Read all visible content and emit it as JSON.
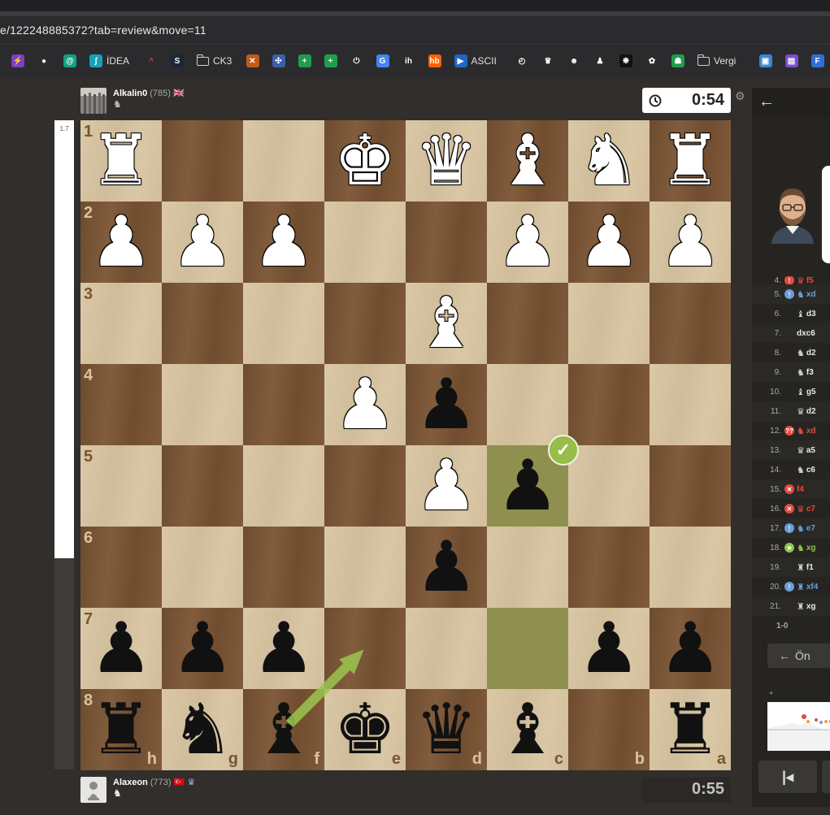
{
  "browser": {
    "url": "e/122248885372?tab=review&move=11",
    "bookmarks": [
      {
        "icon": "bolt-icon",
        "label": "",
        "color": "#7b3fc4",
        "glyph": "⚡"
      },
      {
        "icon": "map-pin-icon",
        "label": "",
        "color": "#2b2b2e",
        "glyph": "●"
      },
      {
        "icon": "chatgpt-spiral-icon",
        "label": "",
        "color": "#10a37f",
        "glyph": "@"
      },
      {
        "icon": "idea-icon",
        "label": "İDEA",
        "color": "#15a2b8",
        "glyph": "ʃ"
      },
      {
        "icon": "chevron-up-red-icon",
        "label": "",
        "color": "#2b2b2e",
        "glyph": "^"
      },
      {
        "icon": "steam-icon",
        "label": "",
        "color": "#1b2838",
        "glyph": "S"
      },
      {
        "icon": "folder-icon",
        "label": "CK3",
        "color": "",
        "glyph": ""
      },
      {
        "icon": "crossed-tools-icon",
        "label": "",
        "color": "#c25a1a",
        "glyph": "✕"
      },
      {
        "icon": "pinwheel-icon",
        "label": "",
        "color": "#3a5fa8",
        "glyph": "✣"
      },
      {
        "icon": "green-cross-icon",
        "label": "",
        "color": "#1e9e4a",
        "glyph": "+"
      },
      {
        "icon": "green-cross-icon-2",
        "label": "",
        "color": "#1e9e4a",
        "glyph": "+"
      },
      {
        "icon": "power-icon",
        "label": "",
        "color": "#2b2b2e",
        "glyph": "⏻"
      },
      {
        "icon": "translate-icon",
        "label": "",
        "color": "#4285f4",
        "glyph": "G"
      },
      {
        "icon": "ih-icon",
        "label": "",
        "color": "#2b2b2e",
        "glyph": "ih"
      },
      {
        "icon": "hb-icon",
        "label": "",
        "color": "#ff6000",
        "glyph": "hb"
      },
      {
        "icon": "play-icon",
        "label": "ASCII",
        "color": "#1e66c9",
        "glyph": "▶"
      },
      {
        "icon": "speedometer-icon",
        "label": "",
        "color": "#2b2b2e",
        "glyph": "◴"
      },
      {
        "icon": "crown-icon",
        "label": "",
        "color": "#2b2b2e",
        "glyph": "♛"
      },
      {
        "icon": "alien-icon",
        "label": "",
        "color": "#2b2b2e",
        "glyph": "☻"
      },
      {
        "icon": "chess-pawn-icon",
        "label": "",
        "color": "#2b2b2e",
        "glyph": "♟"
      },
      {
        "icon": "snowflake-icon",
        "label": "",
        "color": "#111111",
        "glyph": "❋"
      },
      {
        "icon": "openai-icon",
        "label": "",
        "color": "#2b2b2e",
        "glyph": "✿"
      },
      {
        "icon": "android-icon",
        "label": "",
        "color": "#1e9e4a",
        "glyph": "☗"
      },
      {
        "icon": "folder-icon-2",
        "label": "Vergi",
        "color": "",
        "glyph": ""
      },
      {
        "icon": "id-card-icon",
        "label": "",
        "color": "#3a86d4",
        "glyph": "▣"
      },
      {
        "icon": "purple-stack-icon",
        "label": "",
        "color": "#7d4ad1",
        "glyph": "▤"
      },
      {
        "icon": "f-icon",
        "label": "",
        "color": "#2f6fd6",
        "glyph": "F"
      }
    ]
  },
  "top_player": {
    "name": "Alkalin0",
    "rating": "(785)",
    "flag": "🇬🇧",
    "clock": "0:54"
  },
  "bottom_player": {
    "name": "Alaxeon",
    "rating": "(773)",
    "flag": "🇹🇷",
    "clock": "0:55"
  },
  "eval_bar": {
    "score": "1.7",
    "white_fraction": 0.675
  },
  "board": {
    "orientation": "black",
    "light_color": "#d8c4a1",
    "dark_color": "#7a5433",
    "highlight_squares": [
      "c5",
      "c7"
    ],
    "pieces": [
      {
        "square": "a1",
        "type": "rook",
        "color": "white"
      },
      {
        "square": "e1",
        "type": "king",
        "color": "white"
      },
      {
        "square": "d1",
        "type": "queen",
        "color": "white"
      },
      {
        "square": "c1",
        "type": "bishop",
        "color": "white"
      },
      {
        "square": "b1",
        "type": "knight",
        "color": "white"
      },
      {
        "square": "h1",
        "type": "rook",
        "color": "white"
      },
      {
        "square": "h2",
        "type": "pawn",
        "color": "white"
      },
      {
        "square": "g2",
        "type": "pawn",
        "color": "white"
      },
      {
        "square": "f2",
        "type": "pawn",
        "color": "white"
      },
      {
        "square": "c2",
        "type": "pawn",
        "color": "white"
      },
      {
        "square": "b2",
        "type": "pawn",
        "color": "white"
      },
      {
        "square": "a2",
        "type": "pawn",
        "color": "white"
      },
      {
        "square": "d3",
        "type": "bishop",
        "color": "white"
      },
      {
        "square": "e4",
        "type": "pawn",
        "color": "white"
      },
      {
        "square": "d4",
        "type": "pawn",
        "color": "black"
      },
      {
        "square": "d5",
        "type": "pawn",
        "color": "white"
      },
      {
        "square": "c5",
        "type": "pawn",
        "color": "black"
      },
      {
        "square": "d6",
        "type": "pawn",
        "color": "black"
      },
      {
        "square": "h7",
        "type": "pawn",
        "color": "black"
      },
      {
        "square": "g7",
        "type": "pawn",
        "color": "black"
      },
      {
        "square": "f7",
        "type": "pawn",
        "color": "black"
      },
      {
        "square": "b7",
        "type": "pawn",
        "color": "black"
      },
      {
        "square": "a7",
        "type": "pawn",
        "color": "black"
      },
      {
        "square": "h8",
        "type": "rook",
        "color": "black"
      },
      {
        "square": "g8",
        "type": "knight",
        "color": "black"
      },
      {
        "square": "f8",
        "type": "bishop",
        "color": "black"
      },
      {
        "square": "e8",
        "type": "king",
        "color": "black"
      },
      {
        "square": "d8",
        "type": "queen",
        "color": "black"
      },
      {
        "square": "c8",
        "type": "bishop",
        "color": "black"
      },
      {
        "square": "a8",
        "type": "rook",
        "color": "black"
      }
    ],
    "arrow": {
      "from": "f8",
      "to": "e7",
      "color": "#9bc54d"
    },
    "move_badge": {
      "square": "c5",
      "icon": "checkmark-icon",
      "color": "#96bc4b"
    }
  },
  "review_panel": {
    "back_icon": "back-arrow-icon",
    "moves": [
      {
        "num": "4.",
        "badge": "mistake",
        "badge_color": "#e6493d",
        "piece": "♛",
        "san": "f5",
        "color": "#e6493d"
      },
      {
        "num": "5.",
        "badge": "inaccuracy",
        "badge_color": "#6b9ed6",
        "piece": "♞",
        "san": "xd",
        "color": "#6b9ed6"
      },
      {
        "num": "6.",
        "badge": "",
        "badge_color": "",
        "piece": "♝",
        "san": "d3",
        "color": "#e8e8e8"
      },
      {
        "num": "7.",
        "badge": "",
        "badge_color": "",
        "piece": "",
        "san": "dxc6",
        "color": "#e8e8e8"
      },
      {
        "num": "8.",
        "badge": "",
        "badge_color": "",
        "piece": "♞",
        "san": "d2",
        "color": "#e8e8e8"
      },
      {
        "num": "9.",
        "badge": "",
        "badge_color": "",
        "piece": "♞",
        "san": "f3",
        "color": "#e8e8e8"
      },
      {
        "num": "10.",
        "badge": "",
        "badge_color": "",
        "piece": "♝",
        "san": "g5",
        "color": "#e8e8e8"
      },
      {
        "num": "11.",
        "badge": "",
        "badge_color": "",
        "piece": "♛",
        "san": "d2",
        "color": "#e8e8e8"
      },
      {
        "num": "12.",
        "badge": "??",
        "badge_color": "#e6493d",
        "piece": "♞",
        "san": "xd",
        "color": "#e6493d"
      },
      {
        "num": "13.",
        "badge": "",
        "badge_color": "",
        "piece": "♛",
        "san": "a5",
        "color": "#e8e8e8"
      },
      {
        "num": "14.",
        "badge": "",
        "badge_color": "",
        "piece": "♞",
        "san": "c6",
        "color": "#e8e8e8"
      },
      {
        "num": "15.",
        "badge": "✕",
        "badge_color": "#e6493d",
        "piece": "",
        "san": "f4",
        "color": "#e6493d"
      },
      {
        "num": "16.",
        "badge": "✕",
        "badge_color": "#e6493d",
        "piece": "♛",
        "san": "c7",
        "color": "#e6493d"
      },
      {
        "num": "17.",
        "badge": "!",
        "badge_color": "#6b9ed6",
        "piece": "♞",
        "san": "e7",
        "color": "#6b9ed6"
      },
      {
        "num": "18.",
        "badge": "★",
        "badge_color": "#8bc34a",
        "piece": "♞",
        "san": "xg",
        "color": "#8bc34a"
      },
      {
        "num": "19.",
        "badge": "",
        "badge_color": "",
        "piece": "♜",
        "san": "f1",
        "color": "#e8e8e8"
      },
      {
        "num": "20.",
        "badge": "!",
        "badge_color": "#6b9ed6",
        "piece": "♜",
        "san": "xf4",
        "color": "#6b9ed6"
      },
      {
        "num": "21.",
        "badge": "",
        "badge_color": "",
        "piece": "♜",
        "san": "xg",
        "color": "#e8e8e8"
      }
    ],
    "result": "1-0",
    "prev_button": "Ön",
    "first_button_glyph": "K"
  }
}
